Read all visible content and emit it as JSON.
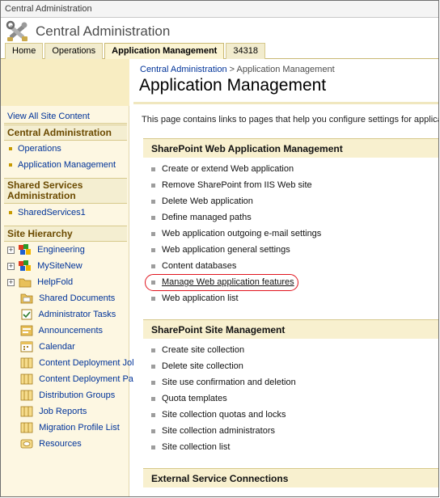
{
  "window": {
    "title": "Central Administration"
  },
  "header": {
    "site_title": "Central Administration"
  },
  "tabs": [
    {
      "label": "Home",
      "active": false
    },
    {
      "label": "Operations",
      "active": false
    },
    {
      "label": "Application Management",
      "active": true
    },
    {
      "label": "34318",
      "active": false
    }
  ],
  "leftnav": {
    "view_all": "View All Site Content",
    "sections": [
      {
        "header": "Central Administration",
        "items": [
          "Operations",
          "Application Management"
        ]
      },
      {
        "header": "Shared Services Administration",
        "items": [
          "SharedServices1"
        ]
      }
    ],
    "hierarchy": {
      "header": "Site Hierarchy",
      "items": [
        {
          "label": "Engineering",
          "icon": "site-icon",
          "expandable": true
        },
        {
          "label": "MySiteNew",
          "icon": "site-icon",
          "expandable": true
        },
        {
          "label": "HelpFold",
          "icon": "folder-icon",
          "expandable": true
        },
        {
          "label": "Shared Documents",
          "icon": "document-library-icon",
          "expandable": false
        },
        {
          "label": "Administrator Tasks",
          "icon": "tasks-icon",
          "expandable": false
        },
        {
          "label": "Announcements",
          "icon": "announcements-icon",
          "expandable": false
        },
        {
          "label": "Calendar",
          "icon": "calendar-icon",
          "expandable": false
        },
        {
          "label": "Content Deployment Jol",
          "icon": "list-icon",
          "expandable": false
        },
        {
          "label": "Content Deployment Pa",
          "icon": "list-icon",
          "expandable": false
        },
        {
          "label": "Distribution Groups",
          "icon": "list-icon",
          "expandable": false
        },
        {
          "label": "Job Reports",
          "icon": "list-icon",
          "expandable": false
        },
        {
          "label": "Migration Profile List",
          "icon": "list-icon",
          "expandable": false
        },
        {
          "label": "Resources",
          "icon": "resources-icon",
          "expandable": false
        }
      ]
    }
  },
  "main": {
    "breadcrumb": {
      "root": "Central Administration",
      "separator": " > ",
      "current": "Application Management"
    },
    "page_title": "Application Management",
    "description": "This page contains links to pages that help you configure settings for applica",
    "sections": [
      {
        "header": "SharePoint Web Application Management",
        "links": [
          "Create or extend Web application",
          "Remove SharePoint from IIS Web site",
          "Delete Web application",
          "Define managed paths",
          "Web application outgoing e-mail settings",
          "Web application general settings",
          "Content databases",
          "Manage Web application features",
          "Web application list"
        ],
        "highlighted_index": 7
      },
      {
        "header": "SharePoint Site Management",
        "links": [
          "Create site collection",
          "Delete site collection",
          "Site use confirmation and deletion",
          "Quota templates",
          "Site collection quotas and locks",
          "Site collection administrators",
          "Site collection list"
        ]
      },
      {
        "header": "External Service Connections",
        "links": []
      }
    ]
  },
  "colors": {
    "accent": "#c79a00",
    "link": "#003399",
    "highlight": "#e0141e"
  }
}
